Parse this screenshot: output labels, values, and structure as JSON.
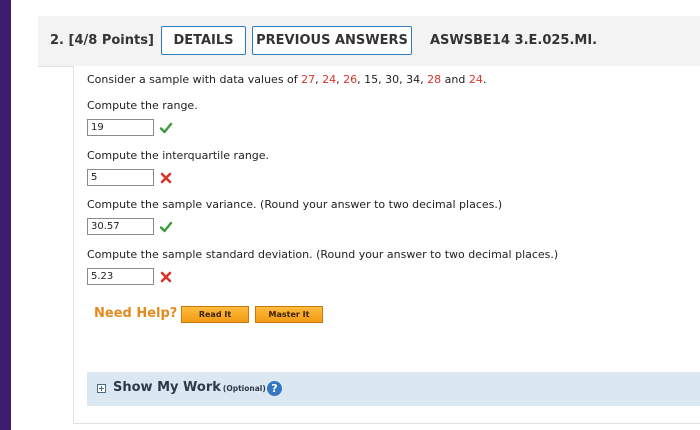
{
  "question": {
    "number": "2.",
    "points": "[4/8 Points]",
    "details_label": "DETAILS",
    "previous_answers_label": "PREVIOUS ANSWERS",
    "code": "ASWSBE14 3.E.025.MI."
  },
  "intro": {
    "text_before": "Consider a sample with data values of ",
    "values": [
      "27",
      "24",
      "26",
      "15",
      "30",
      "34",
      "28",
      "24"
    ],
    "sep": ", ",
    "and_word": " and ",
    "period": "."
  },
  "parts": [
    {
      "prompt": "Compute the range.",
      "answer": "19",
      "status": "correct"
    },
    {
      "prompt": "Compute the interquartile range.",
      "answer": "5",
      "status": "incorrect"
    },
    {
      "prompt": "Compute the sample variance. (Round your answer to two decimal places.)",
      "answer": "30.57",
      "status": "correct"
    },
    {
      "prompt": "Compute the sample standard deviation. (Round your answer to two decimal places.)",
      "answer": "5.23",
      "status": "incorrect"
    }
  ],
  "help": {
    "label": "Need Help?",
    "read_it": "Read It",
    "master_it": "Master It"
  },
  "show_my_work": {
    "label": "Show My Work",
    "optional": "(Optional)",
    "help_glyph": "?"
  },
  "colors": {
    "accent_blue": "#2e7bbf",
    "highlight_red": "#d9342b",
    "correct_green": "#3c9a3c",
    "need_help_orange": "#e58a1f",
    "side_purple": "#3d1d6c"
  },
  "icons": {
    "correct": "check-icon",
    "incorrect": "x-mark-icon",
    "expand": "plus-box-icon",
    "help": "question-circle-icon"
  }
}
